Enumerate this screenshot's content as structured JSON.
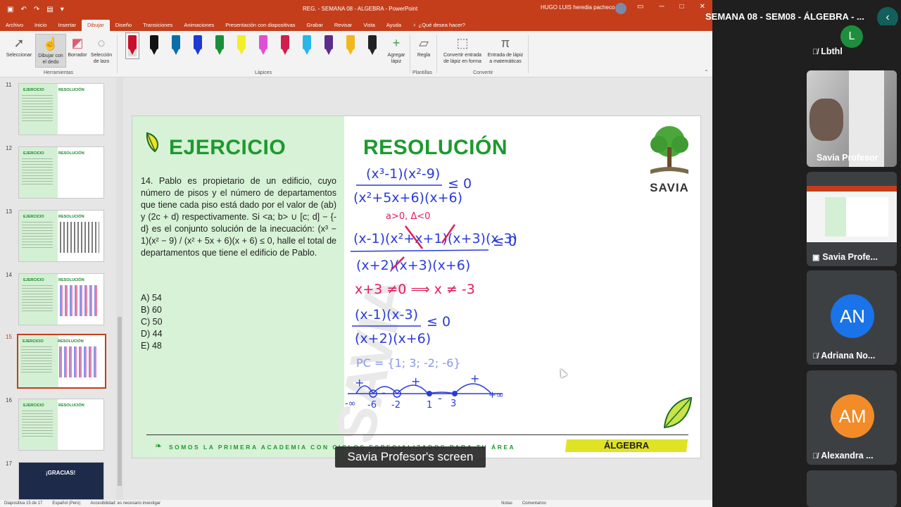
{
  "powerpoint": {
    "window_title": "REG. - SEMANA 08 - ALGEBRA  -  PowerPoint",
    "user_name": "HUGO LUIS heredia pacheco",
    "tabs": [
      "Archivo",
      "Inicio",
      "Insertar",
      "Dibujar",
      "Diseño",
      "Transiciones",
      "Animaciones",
      "Presentación con diapositivas",
      "Grabar",
      "Revisar",
      "Vista",
      "Ayuda"
    ],
    "active_tab": "Dibujar",
    "tell_me": "¿Qué desea hacer?",
    "ribbon": {
      "seleccionar": "Seleccionar",
      "dibujar_dedo": "Dibujar con el dedo",
      "borrador": "Borrador",
      "seleccion_lazo": "Selección de lazo",
      "group_herramientas": "Herramientas",
      "agregar_lapiz": "Agregar lápiz",
      "group_lapices": "Lápices",
      "regla": "Regla",
      "group_plantillas": "Plantillas",
      "convertir_forma": "Convertir entrada de lápiz en forma",
      "entrada_mat": "Entrada de lápiz a matemáticas",
      "group_convertir": "Convertir",
      "pen_colors": [
        "#c8102e",
        "#111111",
        "#0a6ea8",
        "#1f39d1",
        "#1a8f3a",
        "#f2ee2a",
        "#e04fd3",
        "#d11e4a",
        "#2ab6e8",
        "#5a2d8a",
        "#f0b81c",
        "#222222"
      ]
    },
    "thumbnails": [
      {
        "num": "11",
        "left": "EJERCICIO",
        "right": "RESOLUCIÓN"
      },
      {
        "num": "12",
        "left": "EJERCICIO",
        "right": "RESOLUCIÓN"
      },
      {
        "num": "13",
        "left": "EJERCICIO",
        "right": "RESOLUCIÓN"
      },
      {
        "num": "14",
        "left": "EJERCICIO",
        "right": "RESOLUCIÓN"
      },
      {
        "num": "15",
        "left": "EJERCICIO",
        "right": "RESOLUCIÓN"
      },
      {
        "num": "16",
        "left": "EJERCICIO",
        "right": "RESOLUCIÓN"
      },
      {
        "num": "17",
        "left": "¡GRACIAS!",
        "right": ""
      }
    ],
    "status": {
      "slide_of": "Diapositiva 15 de 17",
      "language": "Español (Perú)",
      "accessibility": "Accesibilidad: es necesario investigar",
      "notes": "Notas",
      "comments": "Comentarios"
    }
  },
  "slide": {
    "heading_left": "EJERCICIO",
    "heading_right": "RESOLUCIÓN",
    "problem_text": "14. Pablo es propietario de un edificio, cuyo número de pisos y el número de departamentos que tiene cada piso está dado por el valor de (ab) y (2c + d) respectivamente. Si <a; b> ∪ [c; d] − {-d} es el conjunto solución de la inecuación: (x³ − 1)(x² − 9) / (x² + 5x + 6)(x + 6) ≤ 0, halle el total de departamentos que tiene el edificio de Pablo.",
    "options": [
      "A) 54",
      "B) 60",
      "C) 50",
      "D) 44",
      "E) 48"
    ],
    "logo": "SAVIA",
    "watermark": "SAVIA",
    "footer_text": "SOMOS LA PRIMERA ACADEMIA CON CICLOS ESPECIALIZADOS PARA TU ÁREA",
    "footer_badge": "ÁLGEBRA",
    "handwriting": {
      "line1_num": "(x³-1)(x²-9)",
      "line1_den": "(x²+5x+6)(x+6)",
      "line1_rel": "≤ 0",
      "note_red": "a>0, Δ<0",
      "line2_num": "(x-1)(x²+x+1)(x+3)(x-3)",
      "line2_den": "(x+2)(x+3)(x+6)",
      "line2_rel": "≤ 0",
      "restriction": "x+3 ≠0 ⟹ x ≠ -3",
      "line3_num": "(x-1)(x-3)",
      "line3_den": "(x+2)(x+6)",
      "line3_rel": "≤ 0",
      "pc": "PC = {1; 3; -2; -6}",
      "axis_labels": [
        "-∞",
        "-6",
        "-2",
        "1",
        "3",
        "+∞"
      ],
      "signs": [
        "+",
        "-",
        "+",
        "-",
        "+"
      ]
    }
  },
  "caption": "Savia Profesor's screen",
  "meet": {
    "meeting_title": "SEMANA 08 - SEM08 - ÁLGEBRA - ...",
    "participants": [
      {
        "name": "Lbthl",
        "initial": "L",
        "color": "#1e8e3e",
        "muted": true
      },
      {
        "name": "Savia Profesor",
        "type": "camera",
        "muted": false
      },
      {
        "name": "Savia Profe...",
        "type": "screen",
        "muted": false
      },
      {
        "name": "Adriana No...",
        "initial": "AN",
        "color": "#1a73e8",
        "muted": true
      },
      {
        "name": "Alexandra ...",
        "initial": "AM",
        "color": "#f28b28",
        "muted": true
      }
    ]
  }
}
